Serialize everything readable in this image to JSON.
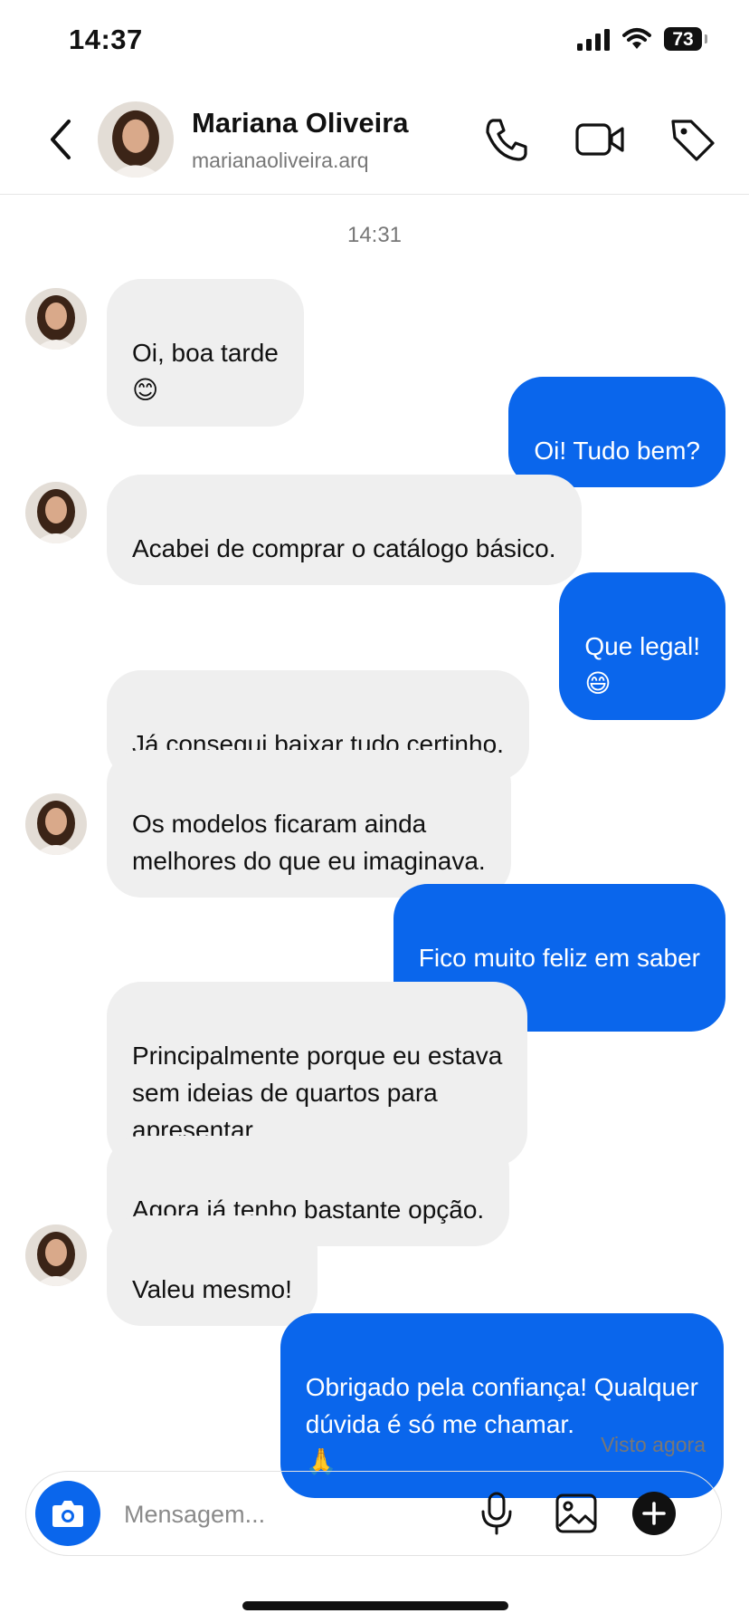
{
  "status_bar": {
    "time": "14:37",
    "battery": "73"
  },
  "header": {
    "name": "Mariana Oliveira",
    "username": "marianaoliveira.arq"
  },
  "conversation": {
    "timestamp": "14:31",
    "messages": [
      {
        "from": "contact",
        "text": "Oi, boa tarde",
        "emoji": "😊"
      },
      {
        "from": "me",
        "text": "Oi! Tudo bem?"
      },
      {
        "from": "contact",
        "text": "Acabei de comprar o catálogo básico."
      },
      {
        "from": "me",
        "text": "Que legal!",
        "emoji": "😄"
      },
      {
        "from": "contact",
        "text": "Já consegui baixar tudo certinho."
      },
      {
        "from": "contact",
        "text": "Os modelos ficaram ainda\nmelhores do que eu imaginava."
      },
      {
        "from": "me",
        "text": "Fico muito feliz em saber",
        "emoji": "❤️"
      },
      {
        "from": "contact",
        "text": "Principalmente porque eu estava\nsem ideias de quartos para\napresentar."
      },
      {
        "from": "contact",
        "text": "Agora já tenho bastante opção."
      },
      {
        "from": "contact",
        "text": "Valeu mesmo!"
      },
      {
        "from": "me",
        "text": "Obrigado pela confiança! Qualquer\ndúvida é só me chamar.",
        "emoji": "🙏"
      }
    ],
    "seen_status": "Visto agora"
  },
  "composer": {
    "placeholder": "Mensagem..."
  },
  "colors": {
    "accent": "#0a66ec",
    "incoming_bubble": "#efefef",
    "muted_text": "#777777"
  },
  "icons": [
    "signal-icon",
    "wifi-icon",
    "back-icon",
    "phone-icon",
    "video-icon",
    "tag-icon",
    "camera-icon",
    "microphone-icon",
    "image-icon",
    "plus-icon"
  ]
}
